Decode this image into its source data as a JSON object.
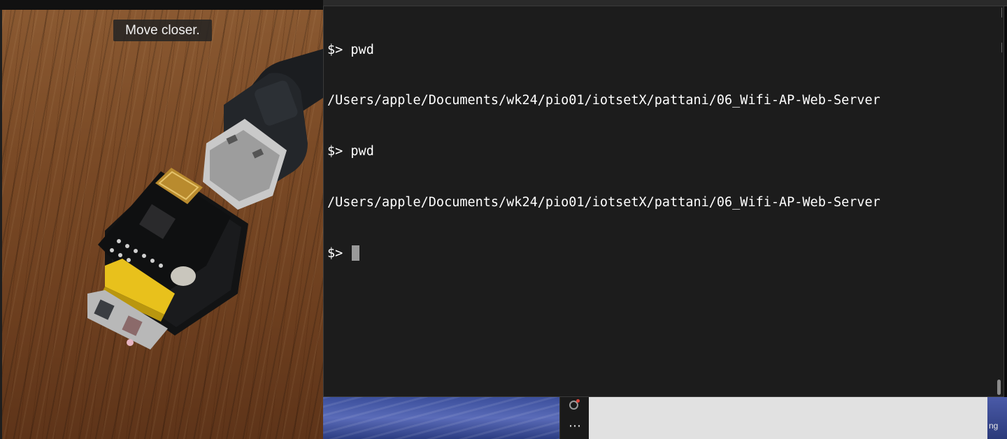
{
  "camera": {
    "caption": "Move closer."
  },
  "terminal": {
    "lines": [
      {
        "prompt": "$>",
        "command": "pwd"
      },
      {
        "output": "/Users/apple/Documents/wk24/pio01/iotsetX/pattani/06_Wifi-AP-Web-Server"
      },
      {
        "prompt": "$>",
        "command": "pwd"
      },
      {
        "output": "/Users/apple/Documents/wk24/pio01/iotsetX/pattani/06_Wifi-AP-Web-Server"
      },
      {
        "prompt": "$>",
        "command": ""
      }
    ]
  },
  "dock": {
    "record_icon": "record-icon",
    "more_icon": "more-icon"
  },
  "right_strip": {
    "text": "ng"
  },
  "colors": {
    "terminal_bg": "#1c1c1c",
    "terminal_text": "#ffffff",
    "caption_bg": "#232323",
    "record_dot": "#e0443a"
  }
}
